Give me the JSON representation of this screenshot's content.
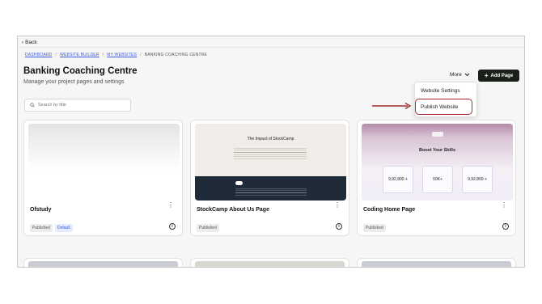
{
  "nav": {
    "back_label": "Back"
  },
  "breadcrumb": [
    "DASHBOARD",
    "WEBSITE BUILDER",
    "MY WEBSITES",
    "BANKING COACHING CENTRE"
  ],
  "header": {
    "title": "Banking Coaching Centre",
    "subtitle": "Manage your project pages and settings",
    "more_label": "More",
    "add_page_label": "Add Page"
  },
  "dropdown": {
    "items": [
      "Website Settings",
      "Publish Website"
    ]
  },
  "search": {
    "placeholder": "Search by title"
  },
  "cards": [
    {
      "name": "Ofstudy",
      "status": "Published",
      "badge": "Default"
    },
    {
      "name": "StockCamp About Us Page",
      "status": "Published",
      "thumb_title": "The Impact of StockCamp"
    },
    {
      "name": "Coding Home Page",
      "status": "Published",
      "thumb_title": "Boost Your Skills",
      "stats": [
        "9,92,800 +",
        "50K+",
        "9,92,800 +"
      ]
    }
  ],
  "colors": {
    "accent_dark": "#1a1f1a",
    "highlight_red": "#a32a2f",
    "link_blue": "#3b5bdb"
  }
}
